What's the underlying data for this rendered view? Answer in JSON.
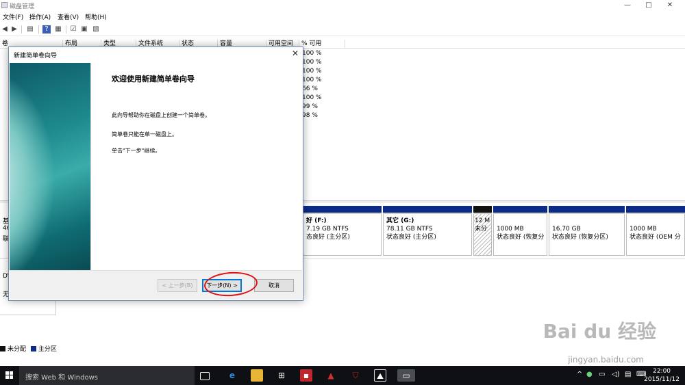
{
  "window": {
    "title": "磁盘管理",
    "minimize": "—",
    "maximize": "□",
    "close": "✕"
  },
  "menu": [
    "文件(F)",
    "操作(A)",
    "查看(V)",
    "帮助(H)"
  ],
  "volume_table": {
    "columns": [
      "卷",
      "布局",
      "类型",
      "文件系统",
      "状态",
      "容量",
      "可用空间",
      "% 可用"
    ],
    "pct_free": [
      "100 %",
      "100 %",
      "100 %",
      "100 %",
      "66 %",
      "100 %",
      "99 %",
      "98 %"
    ]
  },
  "disks": {
    "disk0": {
      "label_fragment": "基",
      "size_fragment": "46",
      "status_fragment": "联"
    },
    "cd": {
      "label_fragment": "DV",
      "status_fragment": "无"
    }
  },
  "partitions": [
    {
      "name": "F",
      "title": "好 (F:)",
      "size": "7.19 GB NTFS",
      "status": "态良好 (主分区)"
    },
    {
      "name": "G",
      "title": "其它 (G:)",
      "size": "78.11 GB NTFS",
      "status": "状态良好 (主分区)"
    },
    {
      "name": "unallocated",
      "title": "12 M",
      "size": "未分",
      "status": ""
    },
    {
      "name": "recovery1",
      "title": "",
      "size": "1000 MB",
      "status": "状态良好 (恢复分"
    },
    {
      "name": "recovery2",
      "title": "",
      "size": "16.70 GB",
      "status": "状态良好 (恢复分区)"
    },
    {
      "name": "oem",
      "title": "",
      "size": "1000 MB",
      "status": "状态良好 (OEM 分"
    }
  ],
  "legend": {
    "unallocated": "未分配",
    "primary": "主分区"
  },
  "colors": {
    "primary_partition": "#0b2a8a",
    "unallocated": "#111111",
    "accent": "#0078d7",
    "annotation": "#e01010"
  },
  "wizard": {
    "title": "新建简单卷向导",
    "heading": "欢迎使用新建简单卷向导",
    "text1": "此向导帮助你在磁盘上创建一个简单卷。",
    "text2": "简单卷只能在单一磁盘上。",
    "text3": "单击\"下一步\"继续。",
    "back": "< 上一步(B)",
    "next": "下一步(N) >",
    "cancel": "取消"
  },
  "taskbar": {
    "search_placeholder": "搜索 Web 和 Windows",
    "time": "22:00",
    "date": "2015/11/12"
  },
  "watermark": {
    "brand": "Bai du 经验",
    "url": "jingyan.baidu.com"
  }
}
